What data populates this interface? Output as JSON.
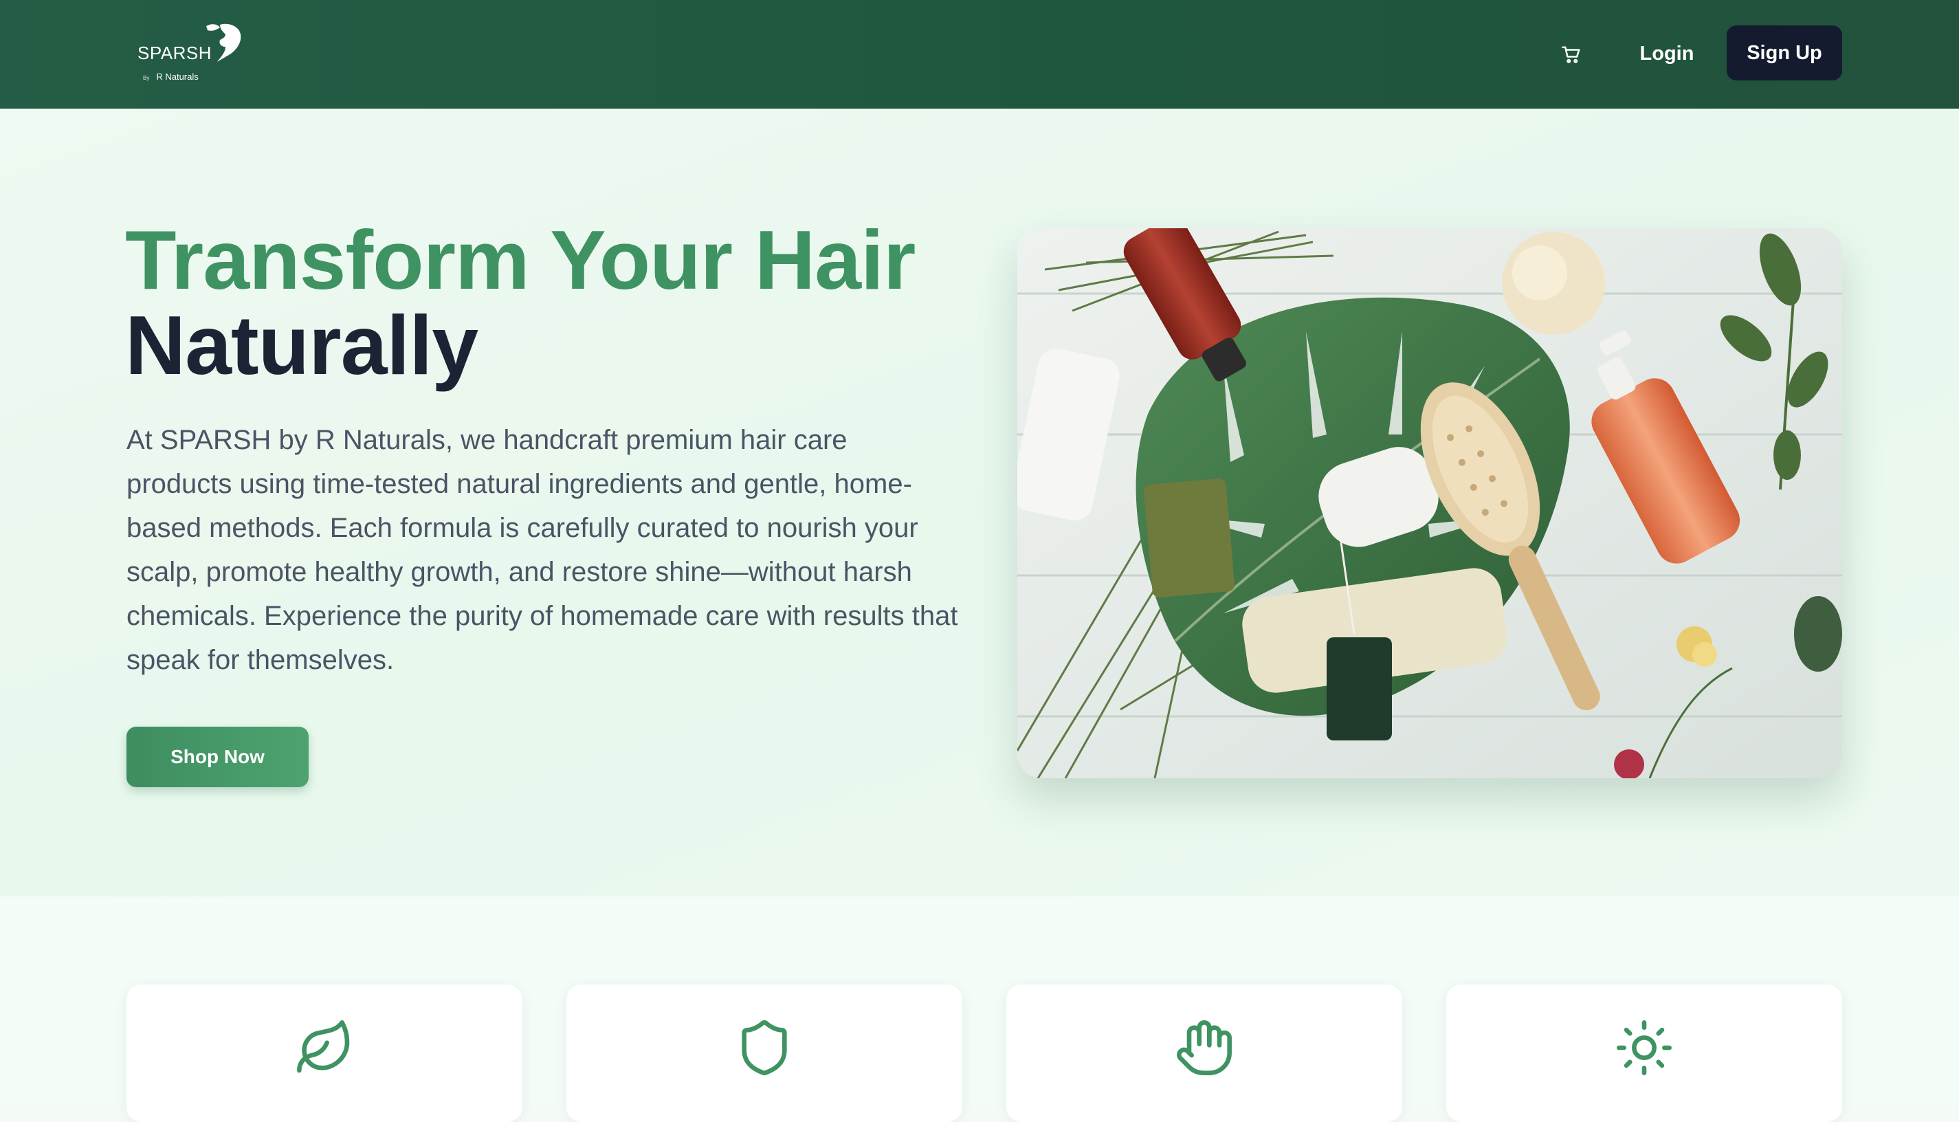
{
  "nav": {
    "logo": {
      "wordmark": "SPARSH",
      "by": "By",
      "sub": "R Naturals"
    },
    "cart_icon": "cart-icon",
    "login_label": "Login",
    "signup_label": "Sign Up"
  },
  "hero": {
    "title_line1": "Transform Your Hair",
    "title_line2": "Naturally",
    "description": "At SPARSH by R Naturals, we handcraft premium hair care products using time-tested natural ingredients and gentle, home-based methods. Each formula is carefully curated to nourish your scalp, promote healthy growth, and restore shine—without harsh chemicals. Experience the purity of homemade care with results that speak for themselves.",
    "cta_label": "Shop Now"
  },
  "features": {
    "cards": [
      {
        "icon": "leaf-icon"
      },
      {
        "icon": "shield-icon"
      },
      {
        "icon": "hand-icon"
      },
      {
        "icon": "sun-icon"
      }
    ]
  },
  "colors": {
    "nav_bg": "#245c45",
    "accent_green": "#3f9363",
    "dark_text": "#1b2434",
    "signup_bg": "#151b2e"
  }
}
